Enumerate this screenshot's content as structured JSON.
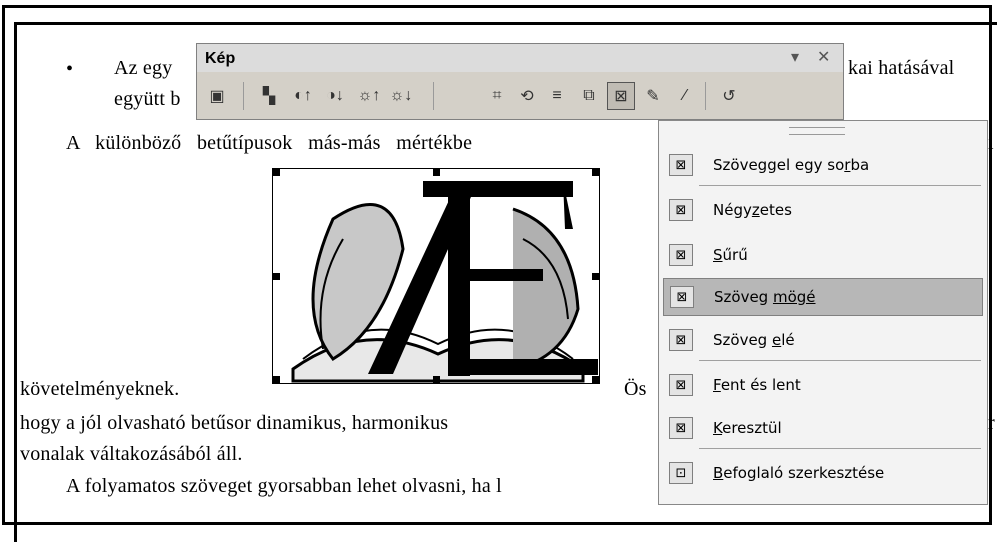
{
  "document": {
    "bullet_char": "•",
    "line1_a": "Az egy",
    "line1_b": "kai hatásával",
    "line2": "együtt b",
    "line3": "A   különböző   betűtípusok   más-más   mértékbe",
    "line3_tail": "i",
    "line4": "követelményeknek.",
    "line4_tail": "Ös",
    "line5": "hogy a jól olvasható betűsor dinamikus, harmonikus",
    "line5_tail": "r",
    "line6": "vonalak váltakozásából áll.",
    "line7": "A folyamatos szöveget gyorsabban lehet olvasni, ha l"
  },
  "toolbar": {
    "title": "Kép",
    "dropdown_glyph": "▾",
    "close_glyph": "✕",
    "buttons": [
      {
        "name": "insert-picture-icon",
        "glyph": "▣"
      },
      {
        "name": "color-icon",
        "glyph": "▚"
      },
      {
        "name": "more-contrast-icon",
        "glyph": "◐↑"
      },
      {
        "name": "less-contrast-icon",
        "glyph": "◑↓"
      },
      {
        "name": "more-brightness-icon",
        "glyph": "☼↑"
      },
      {
        "name": "less-brightness-icon",
        "glyph": "☼↓"
      },
      {
        "name": "crop-icon",
        "glyph": "⌗"
      },
      {
        "name": "rotate-left-icon",
        "glyph": "⟲"
      },
      {
        "name": "line-style-icon",
        "glyph": "≡"
      },
      {
        "name": "compress-pictures-icon",
        "glyph": "⧉"
      },
      {
        "name": "text-wrapping-icon",
        "glyph": "⊠"
      },
      {
        "name": "format-picture-icon",
        "glyph": "✎"
      },
      {
        "name": "set-transparent-color-icon",
        "glyph": "⁄"
      },
      {
        "name": "reset-picture-icon",
        "glyph": "↺"
      }
    ]
  },
  "menu": {
    "items": [
      {
        "pre": "Szöveggel egy so",
        "u": "r",
        "post": "ba",
        "icon": "⊠"
      },
      {
        "pre": "Négy",
        "u": "z",
        "post": "etes",
        "icon": "⊠"
      },
      {
        "pre": "",
        "u": "S",
        "post": "űrű",
        "icon": "⊠"
      },
      {
        "pre": "Szöveg ",
        "u": "mögé",
        "post": "",
        "icon": "⊠"
      },
      {
        "pre": "Szöveg ",
        "u": "e",
        "post": "lé",
        "icon": "⊠"
      },
      {
        "pre": "",
        "u": "F",
        "post": "ent és lent",
        "icon": "⊠"
      },
      {
        "pre": "",
        "u": "K",
        "post": "eresztül",
        "icon": "⊠"
      },
      {
        "pre": "",
        "u": "B",
        "post": "efoglaló szerkesztése",
        "icon": "⊡"
      }
    ]
  }
}
